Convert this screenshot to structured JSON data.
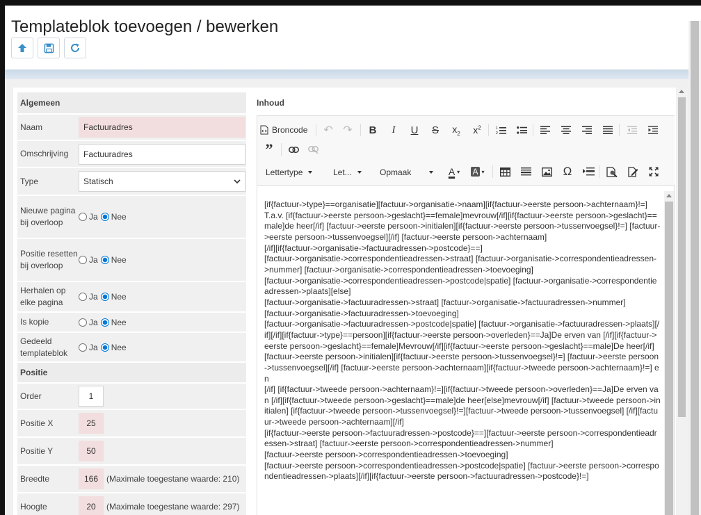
{
  "title": "Templateblok toevoegen / bewerken",
  "toolbar": {
    "icons": [
      "arrow-up-icon",
      "save-icon",
      "refresh-icon"
    ]
  },
  "left": {
    "section_general": "Algemeen",
    "naam_label": "Naam",
    "naam_value": "Factuuradres",
    "omschrijving_label": "Omschrijving",
    "omschrijving_value": "Factuuradres",
    "type_label": "Type",
    "type_value": "Statisch",
    "nieuwe_label": "Nieuwe pagina bij overloop",
    "positie_reset_label": "Positie resetten bij overloop",
    "herhalen_label": "Herhalen op elke pagina",
    "kopie_label": "Is kopie",
    "gedeeld_label": "Gedeeld templateblok",
    "ja": "Ja",
    "nee": "Nee",
    "section_positie": "Positie",
    "order_label": "Order",
    "order_value": "1",
    "posx_label": "Positie X",
    "posx_value": "25",
    "posy_label": "Positie Y",
    "posy_value": "50",
    "breedte_label": "Breedte",
    "breedte_value": "166",
    "breedte_hint": "(Maximale toegestane waarde: 210)",
    "hoogte_label": "Hoogte",
    "hoogte_value": "20",
    "hoogte_hint": "(Maximale toegestane waarde: 297)"
  },
  "right": {
    "section_label": "Inhoud",
    "broncode": "Broncode",
    "lettertype": "Lettertype",
    "grootte": "Let...",
    "opmaak": "Opmaak",
    "content": "[if{factuur->type}==organisatie][factuur->organisatie->naam][if{factuur->eerste persoon->achternaam}!=]\nT.a.v. [if{factuur->eerste persoon->geslacht}==female]mevrouw[/if][if{factuur->eerste persoon->geslacht}==male]de heer[/if] [factuur->eerste persoon->initialen][if{factuur->eerste persoon->tussenvoegsel}!=] [factuur->eerste persoon->tussenvoegsel][/if] [factuur->eerste persoon->achternaam]\n[/if][if{factuur->organisatie->factuuradressen->postcode}==]\n[factuur->organisatie->correspondentieadressen->straat] [factuur->organisatie->correspondentieadressen->nummer] [factuur->organisatie->correspondentieadressen->toevoeging]\n[factuur->organisatie->correspondentieadressen->postcode|spatie] [factuur->organisatie->correspondentieadressen->plaats][else]\n[factuur->organisatie->factuuradressen->straat] [factuur->organisatie->factuuradressen->nummer]\n[factuur->organisatie->factuuradressen->toevoeging]\n[factuur->organisatie->factuuradressen->postcode|spatie] [factuur->organisatie->factuuradressen->plaats][/if][/if][if{factuur->type}==persoon][if{factuur->eerste persoon->overleden}==Ja]De erven van [/if][if{factuur->eerste persoon->geslacht}==female]Mevrouw[/if][if{factuur->eerste persoon->geslacht}==male]De heer[/if] [factuur->eerste persoon->initialen][if{factuur->eerste persoon->tussenvoegsel}!=] [factuur->eerste persoon->tussenvoegsel][/if] [factuur->eerste persoon->achternaam][if{factuur->tweede persoon->achternaam}!=] en\n[/if] [if{factuur->tweede persoon->achternaam}!=][if{factuur->tweede persoon->overleden}==Ja]De erven van [/if][if{factuur->tweede persoon->geslacht}==male]de heer[else]mevrouw[/if] [factuur->tweede persoon->initialen] [if{factuur->tweede persoon->tussenvoegsel}!=][factuur->tweede persoon->tussenvoegsel] [/if][factuur->tweede persoon->achternaam][/if]\n[if{factuur->eerste persoon->factuuradressen->postcode}==][factuur->eerste persoon->correspondentieadressen->straat] [factuur->eerste persoon->correspondentieadressen->nummer]\n[factuur->eerste persoon->correspondentieadressen->toevoeging]\n[factuur->eerste persoon->correspondentieadressen->postcode|spatie] [factuur->eerste persoon->correspondentieadressen->plaats][/if][if{factuur->eerste persoon->factuuradressen->postcode}!=]"
  }
}
